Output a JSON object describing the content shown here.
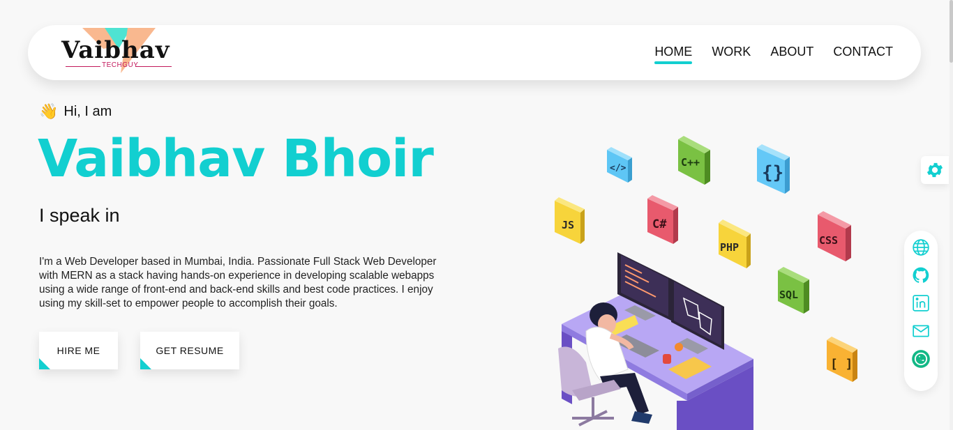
{
  "nav": {
    "logo_text": "Vaibhav",
    "logo_sub": "TECHGUY",
    "links": [
      "HOME",
      "WORK",
      "ABOUT",
      "CONTACT"
    ],
    "active": "HOME"
  },
  "hero": {
    "greeting": "Hi, I am",
    "wave_icon": "👋",
    "name": "Vaibhav Bhoir",
    "speak": "I speak in",
    "description": "I'm a Web Developer based in Mumbai, India. Passionate Full Stack Web Developer with MERN as a stack having hands-on experience in developing scalable webapps using a wide range of front-end and back-end skills and best code practices. I enjoy using my skill-set to empower people to accomplish their goals.",
    "buttons": {
      "hire": "HIRE ME",
      "resume": "GET RESUME"
    }
  },
  "illustration": {
    "cubes": [
      {
        "label": "</>",
        "color": "#5ec6f5"
      },
      {
        "label": "C++",
        "color": "#7ac143"
      },
      {
        "label": "{}",
        "color": "#64c8f7"
      },
      {
        "label": "JS",
        "color": "#f7d43b"
      },
      {
        "label": "C#",
        "color": "#e85a6d"
      },
      {
        "label": "PHP",
        "color": "#f7d43b"
      },
      {
        "label": "CSS",
        "color": "#e85a6d"
      },
      {
        "label": "SQL",
        "color": "#7ac143"
      },
      {
        "label": "[ ]",
        "color": "#f9b233"
      }
    ]
  },
  "side": {
    "settings_icon": "gear-icon",
    "social_icons": [
      "globe-icon",
      "github-icon",
      "linkedin-icon",
      "mail-icon",
      "whatsapp-icon"
    ]
  },
  "colors": {
    "accent": "#12cfd0",
    "navbar_bg": "#ffffff",
    "page_bg": "#f8f8f8"
  }
}
